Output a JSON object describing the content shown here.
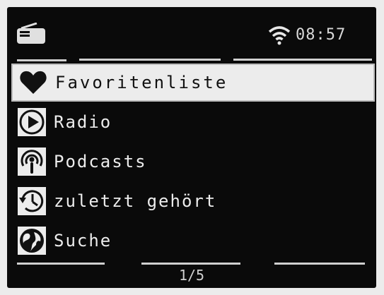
{
  "status_bar": {
    "time": "08:57",
    "icons": [
      "radio-icon",
      "wifi-icon"
    ]
  },
  "menu": {
    "items": [
      {
        "label": "Favoritenliste",
        "icon": "heart-icon",
        "selected": true
      },
      {
        "label": "Radio",
        "icon": "play-icon",
        "selected": false
      },
      {
        "label": "Podcasts",
        "icon": "podcast-icon",
        "selected": false
      },
      {
        "label": "zuletzt gehört",
        "icon": "clock-icon",
        "selected": false
      },
      {
        "label": "Suche",
        "icon": "globe-icon",
        "selected": false
      }
    ]
  },
  "pagination": {
    "text": "1/5"
  },
  "colors": {
    "screen_background": "#0a0a0a",
    "selection_background": "#ececec",
    "text": "#ececec"
  }
}
